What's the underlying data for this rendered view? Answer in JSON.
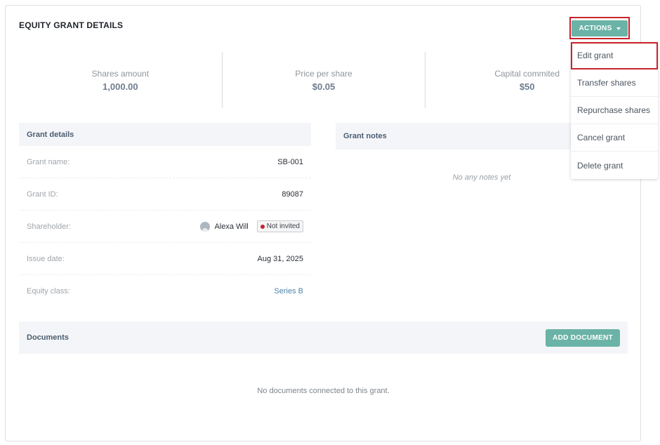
{
  "page": {
    "title": "EQUITY GRANT DETAILS"
  },
  "actions": {
    "label": "ACTIONS",
    "menu": [
      "Edit grant",
      "Transfer shares",
      "Repurchase shares",
      "Cancel grant",
      "Delete grant"
    ]
  },
  "stats": [
    {
      "label": "Shares amount",
      "value": "1,000.00"
    },
    {
      "label": "Price per share",
      "value": "$0.05"
    },
    {
      "label": "Capital commited",
      "value": "$50"
    }
  ],
  "grant_details": {
    "title": "Grant details",
    "rows": {
      "grant_name": {
        "label": "Grant name:",
        "value": "SB-001"
      },
      "grant_id": {
        "label": "Grant ID:",
        "value": "89087"
      },
      "shareholder": {
        "label": "Shareholder:",
        "value": "Alexa Will",
        "badge": "Not invited"
      },
      "issue_date": {
        "label": "Issue date:",
        "value": "Aug 31, 2025"
      },
      "equity_class": {
        "label": "Equity class:",
        "value": "Series B"
      }
    }
  },
  "grant_notes": {
    "title": "Grant notes",
    "empty": "No any notes yet"
  },
  "documents": {
    "title": "Documents",
    "add_label": "ADD DOCUMENT",
    "empty": "No documents connected to this grant."
  },
  "colors": {
    "accent": "#6ab3a6",
    "highlight": "#c8232c",
    "status_dot": "#c0262f",
    "link": "#4d84ad"
  }
}
